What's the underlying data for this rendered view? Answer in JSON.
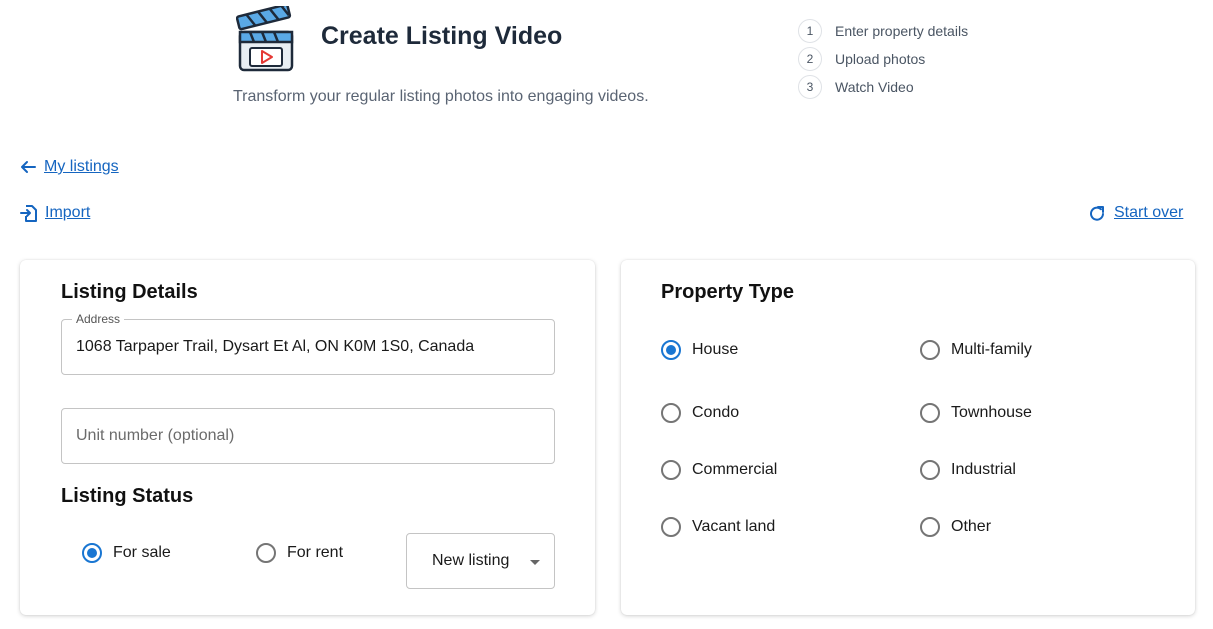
{
  "header": {
    "icon": "clapperboard-video-icon",
    "title": "Create Listing Video",
    "subtitle": "Transform your regular listing photos into engaging videos."
  },
  "steps": [
    {
      "number": "1",
      "label": "Enter property details"
    },
    {
      "number": "2",
      "label": "Upload photos"
    },
    {
      "number": "3",
      "label": "Watch Video"
    }
  ],
  "nav": {
    "my_listings": "My listings",
    "import": "Import",
    "start_over": "Start over"
  },
  "listing_details": {
    "title": "Listing Details",
    "address_label": "Address",
    "address_value": "1068 Tarpaper Trail, Dysart Et Al, ON K0M 1S0, Canada",
    "unit_placeholder": "Unit number (optional)"
  },
  "listing_status": {
    "title": "Listing Status",
    "options": [
      {
        "label": "For sale",
        "checked": true
      },
      {
        "label": "For rent",
        "checked": false
      }
    ],
    "select_value": "New listing"
  },
  "property_type": {
    "title": "Property Type",
    "options": [
      {
        "label": "House",
        "checked": true
      },
      {
        "label": "Multi-family",
        "checked": false
      },
      {
        "label": "Condo",
        "checked": false
      },
      {
        "label": "Townhouse",
        "checked": false
      },
      {
        "label": "Commercial",
        "checked": false
      },
      {
        "label": "Industrial",
        "checked": false
      },
      {
        "label": "Vacant land",
        "checked": false
      },
      {
        "label": "Other",
        "checked": false
      }
    ]
  },
  "colors": {
    "accent": "#1976d2",
    "link": "#1565c0",
    "icon_blue": "#5aa9e6",
    "icon_dark": "#1e2a3a"
  }
}
